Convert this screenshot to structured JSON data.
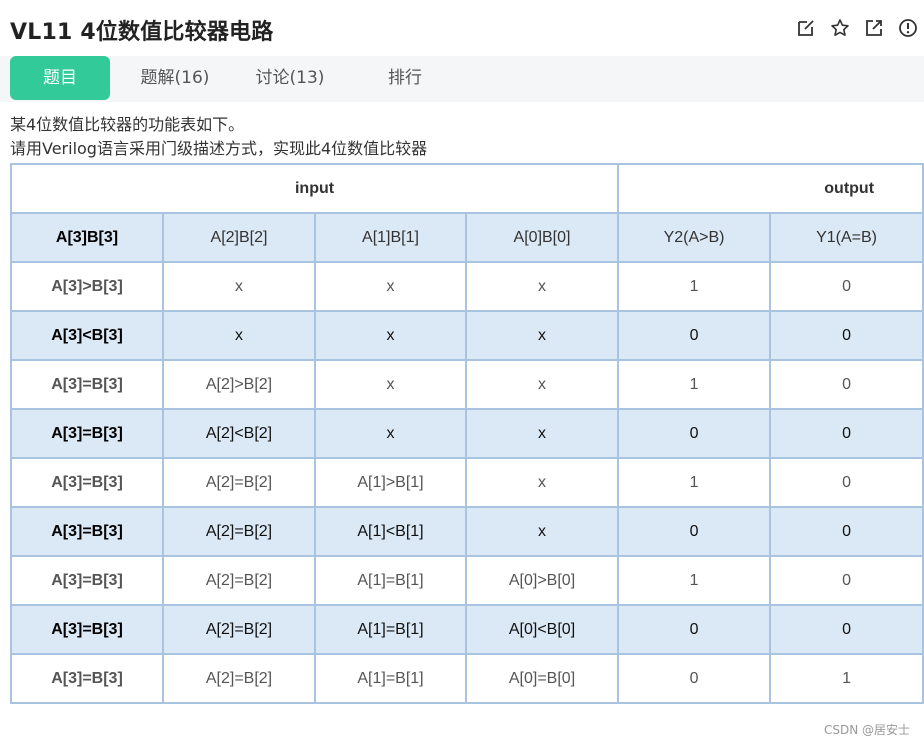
{
  "header": {
    "title": "VL11  4位数值比较器电路",
    "icons": [
      "edit-icon",
      "star-icon",
      "external-link-icon",
      "info-icon"
    ]
  },
  "tabs": [
    {
      "label": "题目",
      "active": true
    },
    {
      "label": "题解(16)",
      "active": false
    },
    {
      "label": "讨论(13)",
      "active": false
    },
    {
      "label": "排行",
      "active": false
    }
  ],
  "description": {
    "line1": "某4位数值比较器的功能表如下。",
    "line2": "请用Verilog语言采用门级描述方式，实现此4位数值比较器"
  },
  "table": {
    "group_headers": {
      "input": "input",
      "output": "output"
    },
    "columns": [
      "A[3]B[3]",
      "A[2]B[2]",
      "A[1]B[1]",
      "A[0]B[0]",
      "Y2(A>B)",
      "Y1(A=B)"
    ],
    "rows": [
      [
        "A[3]>B[3]",
        "x",
        "x",
        "x",
        "1",
        "0"
      ],
      [
        "A[3]<B[3]",
        "x",
        "x",
        "x",
        "0",
        "0"
      ],
      [
        "A[3]=B[3]",
        "A[2]>B[2]",
        "x",
        "x",
        "1",
        "0"
      ],
      [
        "A[3]=B[3]",
        "A[2]<B[2]",
        "x",
        "x",
        "0",
        "0"
      ],
      [
        "A[3]=B[3]",
        "A[2]=B[2]",
        "A[1]>B[1]",
        "x",
        "1",
        "0"
      ],
      [
        "A[3]=B[3]",
        "A[2]=B[2]",
        "A[1]<B[1]",
        "x",
        "0",
        "0"
      ],
      [
        "A[3]=B[3]",
        "A[2]=B[2]",
        "A[1]=B[1]",
        "A[0]>B[0]",
        "1",
        "0"
      ],
      [
        "A[3]=B[3]",
        "A[2]=B[2]",
        "A[1]=B[1]",
        "A[0]<B[0]",
        "0",
        "0"
      ],
      [
        "A[3]=B[3]",
        "A[2]=B[2]",
        "A[1]=B[1]",
        "A[0]=B[0]",
        "0",
        "1"
      ]
    ]
  },
  "watermark": "CSDN @居安士",
  "colors": {
    "accent": "#32ca99",
    "table_border": "#a8c4e0",
    "table_stripe": "#dbe8f5"
  }
}
